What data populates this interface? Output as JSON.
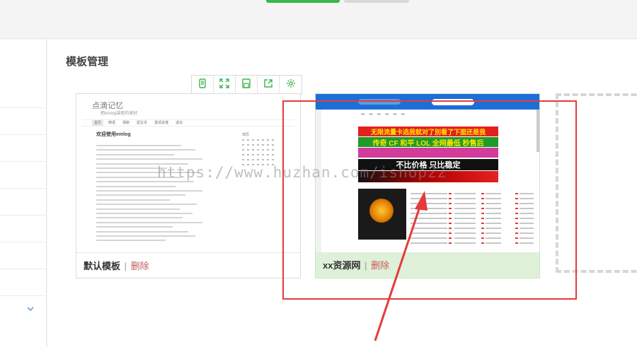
{
  "page": {
    "title": "模板管理"
  },
  "toolbar": {
    "buttons": [
      {
        "name": "mobile-preview",
        "icon": "phone-icon"
      },
      {
        "name": "fullscreen",
        "icon": "expand-icon"
      },
      {
        "name": "save",
        "icon": "save-icon"
      },
      {
        "name": "export",
        "icon": "share-icon"
      },
      {
        "name": "settings",
        "icon": "gear-icon"
      }
    ]
  },
  "templates": [
    {
      "name": "默认模板",
      "delete_label": "删除",
      "separator": "|",
      "selected": false,
      "preview": {
        "site_title": "点滴记忆",
        "site_subtitle": "把emlog装修的更好",
        "nav": [
          "首页",
          "微语",
          "相册",
          "留言本",
          "邀请友链",
          "退出"
        ],
        "post_title": "欢迎使用emlog",
        "sidebar_title": "日历"
      }
    },
    {
      "name": "xx资源网",
      "delete_label": "删除",
      "separator": "|",
      "selected": true,
      "preview": {
        "banner_1": "无限流量卡选我就对了別看了下面还是我",
        "banner_2": "传奇 CF 和平 LOL 全网最低 秒售后",
        "banner_3": "不比价格 只比稳定",
        "accent_color": "#1c6fd6"
      }
    }
  ],
  "watermark": "https://www.huzhan.com/ishop22",
  "colors": {
    "accent_green": "#3bb54a",
    "selected_bg": "#dff0d8",
    "annotation_red": "#e33b3b",
    "delete_red": "#c85a5a"
  }
}
